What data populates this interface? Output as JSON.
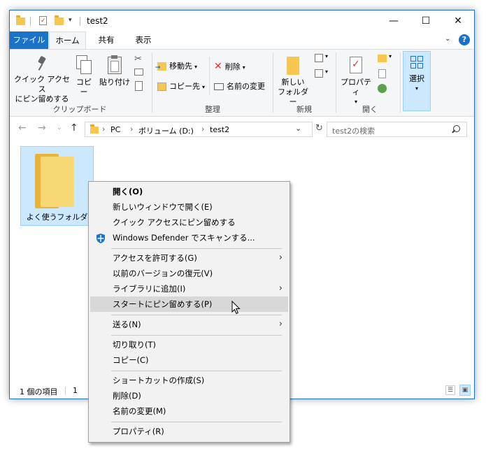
{
  "window": {
    "title": "test2"
  },
  "ribbon_tabs": [
    "ファイル",
    "ホーム",
    "共有",
    "表示"
  ],
  "ribbon": {
    "pin_quick_access": [
      "クイック アクセス",
      "にピン留めする"
    ],
    "copy": "コピー",
    "paste": "貼り付け",
    "clipboard_group": "クリップボード",
    "move_to": "移動先",
    "copy_to": "コピー先",
    "delete": "削除",
    "rename": "名前の変更",
    "organize_group": "整理",
    "new_folder": [
      "新しい",
      "フォルダー"
    ],
    "new_group": "新規",
    "properties": "プロパティ",
    "open_group": "開く",
    "select": "選択"
  },
  "address": {
    "path": [
      "PC",
      "ボリューム (D:)",
      "test2"
    ],
    "search_placeholder": "test2の検索"
  },
  "content": {
    "folder_name": "よく使うフォルダ"
  },
  "status": {
    "item_count": "1 個の項目",
    "selected": "1"
  },
  "context_menu": {
    "items": [
      "開く(O)",
      "新しいウィンドウで開く(E)",
      "クイック アクセスにピン留めする",
      "Windows Defender でスキャンする...",
      "アクセスを許可する(G)",
      "以前のバージョンの復元(V)",
      "ライブラリに追加(I)",
      "スタートにピン留めする(P)",
      "送る(N)",
      "切り取り(T)",
      "コピー(C)",
      "ショートカットの作成(S)",
      "削除(D)",
      "名前の変更(M)",
      "プロパティ(R)"
    ]
  },
  "colors": {
    "accent": "#1a73c9",
    "selection": "#cce8ff",
    "folder": "#f6c64f",
    "menu_highlight": "#d8d8d8"
  }
}
